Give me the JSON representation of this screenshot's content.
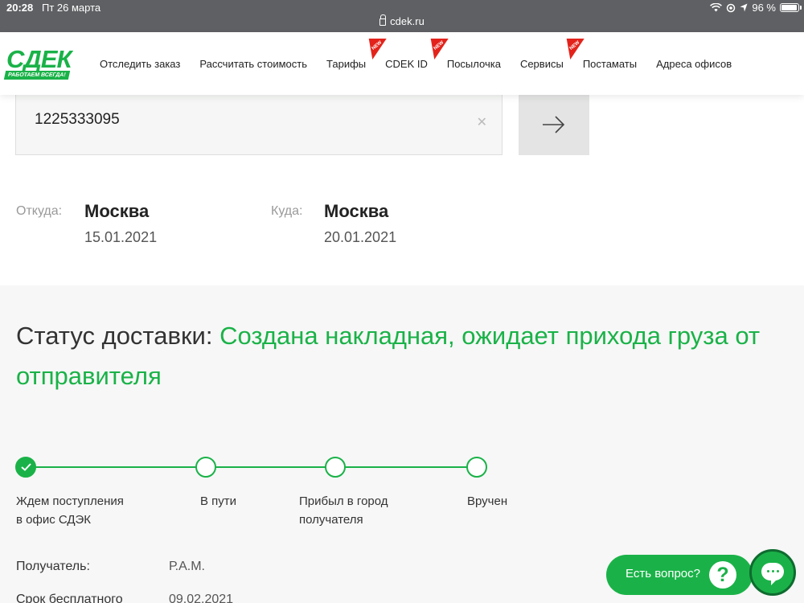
{
  "status_bar": {
    "time": "20:28",
    "date": "Пт 26 марта",
    "url": "cdek.ru",
    "battery": "96 %",
    "battery_level": 0.96
  },
  "header": {
    "logo_text": "СДЕК",
    "logo_tagline": "РАБОТАЕМ ВСЕГДА!",
    "brand_color": "#1ab248",
    "nav": [
      {
        "label": "Отследить заказ",
        "new": false
      },
      {
        "label": "Рассчитать стоимость",
        "new": false
      },
      {
        "label": "Тарифы",
        "new": false
      },
      {
        "label": "CDEK ID",
        "new": true
      },
      {
        "label": "Посылочка",
        "new": true
      },
      {
        "label": "Сервисы",
        "new": false
      },
      {
        "label": "Постаматы",
        "new": true
      },
      {
        "label": "Адреса офисов",
        "new": false
      }
    ],
    "new_badge_text": "NEW"
  },
  "search": {
    "value": "1225333095",
    "clear_icon": "close-icon",
    "submit_icon": "arrow-right-icon"
  },
  "route": {
    "from_label": "Откуда:",
    "from_city": "Москва",
    "from_date": "15.01.2021",
    "to_label": "Куда:",
    "to_city": "Москва",
    "to_date": "20.01.2021"
  },
  "status": {
    "prefix": "Статус доставки: ",
    "text": "Создана накладная, ожидает прихода груза от отправителя",
    "steps": [
      {
        "line1": "Ждем поступления",
        "line2": "в офис СДЭК",
        "done": true
      },
      {
        "line1": "В пути",
        "line2": "",
        "done": false
      },
      {
        "line1": "Прибыл в город",
        "line2": "получателя",
        "done": false
      },
      {
        "line1": "Вручен",
        "line2": "",
        "done": false
      }
    ]
  },
  "details": {
    "recipient_label": "Получатель:",
    "recipient_value": "Р.А.М.",
    "storage_label": "Срок бесплатного",
    "storage_value": "09.02.2021"
  },
  "chat": {
    "ask_label": "Есть вопрос?",
    "ask_icon": "question-icon",
    "chat_icon": "chat-bubble-icon"
  }
}
